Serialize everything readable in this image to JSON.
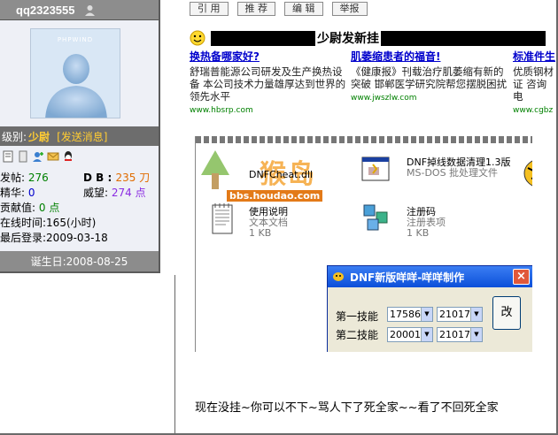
{
  "sidebar": {
    "username": "qq2323555",
    "avatar_logo": "PHPWIND",
    "level_label": "级别:",
    "level_value": "少尉",
    "send_message": "[发送消息]",
    "stats": {
      "posts_label": "发帖:",
      "posts_value": "276",
      "db_label": "D B :",
      "db_value": "235 刀",
      "essence_label": "精华:",
      "essence_value": "0",
      "prestige_label": "威望:",
      "prestige_value": "274 点",
      "contrib_label": "贡献值:",
      "contrib_value": "0 点",
      "online": "在线时间:165(小时)",
      "last_login": "最后登录:2009-03-18"
    },
    "birthday": "诞生日:2008-08-25",
    "colors": {
      "posts": "#008000",
      "db": "#e06c00",
      "essence": "#0000cc",
      "prestige": "#8a2be2",
      "contrib": "#008000"
    }
  },
  "post_buttons": [
    "引 用",
    "推 荐",
    "编 辑",
    "举报"
  ],
  "ad": {
    "center_text": "少尉发新挂",
    "columns": [
      {
        "title": "换热备哪家好?",
        "body": "舒瑞普能源公司研发及生产换热设备 本公司技术力量雄厚达到世界的领先水平",
        "url": "www.hbsrp.com"
      },
      {
        "title": "肌萎缩患者的福音!",
        "body": "《健康报》刊载治疗肌萎缩有新的突破 邯郸医学研究院帮您摆脱困扰",
        "url": "www.jwszlw.com"
      },
      {
        "title": "标准件生",
        "body": "优质钢材 证 咨询电",
        "url": "www.cgbz"
      }
    ]
  },
  "post_image": {
    "files": [
      {
        "name": "DNFCheat.dll",
        "sub": ""
      },
      {
        "name": "DNF掉线数据清理1.3版",
        "sub": "MS-DOS 批处理文件"
      },
      {
        "name": "使用说明",
        "sub": "文本文档",
        "size": "1 KB"
      },
      {
        "name": "注册码",
        "sub": "注册表项",
        "size": "1 KB"
      }
    ],
    "watermark": "bbs.houdao.com",
    "watermark_big": "猴岛",
    "dialog": {
      "title": "DNF新版咩咩-咩咩制作",
      "close": "×",
      "skill1_label": "第一技能",
      "skill2_label": "第二技能",
      "skill1_a": "17586",
      "skill1_b": "21017",
      "skill2_a": "20001",
      "skill2_b": "21017",
      "change_button": "改"
    }
  },
  "post_text": "现在没挂~你可以不下~骂人下了死全家~~看了不回死全家"
}
